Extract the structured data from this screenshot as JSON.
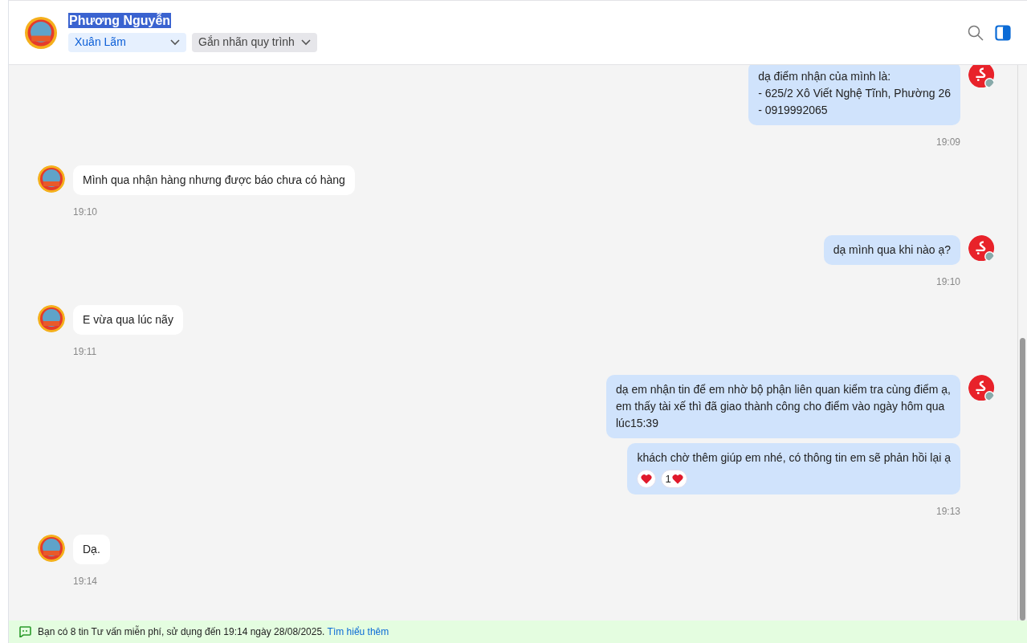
{
  "header": {
    "contact_name": "Phương Nguyễn",
    "name_highlighted": true,
    "dropdowns": [
      {
        "kind": "assignee",
        "label": "Xuân Lãm"
      },
      {
        "kind": "tag",
        "label": "Gắn nhãn quy trình"
      }
    ]
  },
  "messages": [
    {
      "kind": "outgoing",
      "bubbles": [
        {
          "lines": [
            "dạ điểm nhận của mình là:",
            "- 625/2 Xô Viết Nghệ Tĩnh, Phường 26",
            "- 0919992065"
          ]
        }
      ],
      "time": "19:09"
    },
    {
      "kind": "incoming",
      "bubbles": [
        {
          "lines": [
            "Mình qua nhận hàng nhưng được báo chưa có hàng"
          ]
        }
      ],
      "time": "19:10"
    },
    {
      "kind": "outgoing",
      "bubbles": [
        {
          "lines": [
            "dạ mình qua khi nào ạ?"
          ]
        }
      ],
      "time": "19:10"
    },
    {
      "kind": "incoming",
      "bubbles": [
        {
          "lines": [
            "E vừa qua lúc nãy"
          ]
        }
      ],
      "time": "19:11"
    },
    {
      "kind": "outgoing",
      "bubbles": [
        {
          "lines": [
            "dạ em nhận tin để em nhờ bộ phận liên quan kiểm tra cùng điểm ạ,",
            "em thấy tài xế thì đã giao thành công cho điểm vào ngày hôm qua",
            "lúc15:39"
          ]
        },
        {
          "lines": [
            "khách chờ thêm giúp em nhé, có thông tin em sẽ phản hồi lại ạ"
          ],
          "reaction_count": "1"
        }
      ],
      "time": "19:13"
    },
    {
      "kind": "incoming",
      "bubbles": [
        {
          "lines": [
            "Dạ."
          ]
        }
      ],
      "time": "19:14"
    }
  ],
  "footer": {
    "text": "Bạn có 8 tin Tư vấn miễn phí, sử dụng đến 19:14 ngày 28/08/2025.",
    "link": "Tìm hiểu thêm"
  }
}
